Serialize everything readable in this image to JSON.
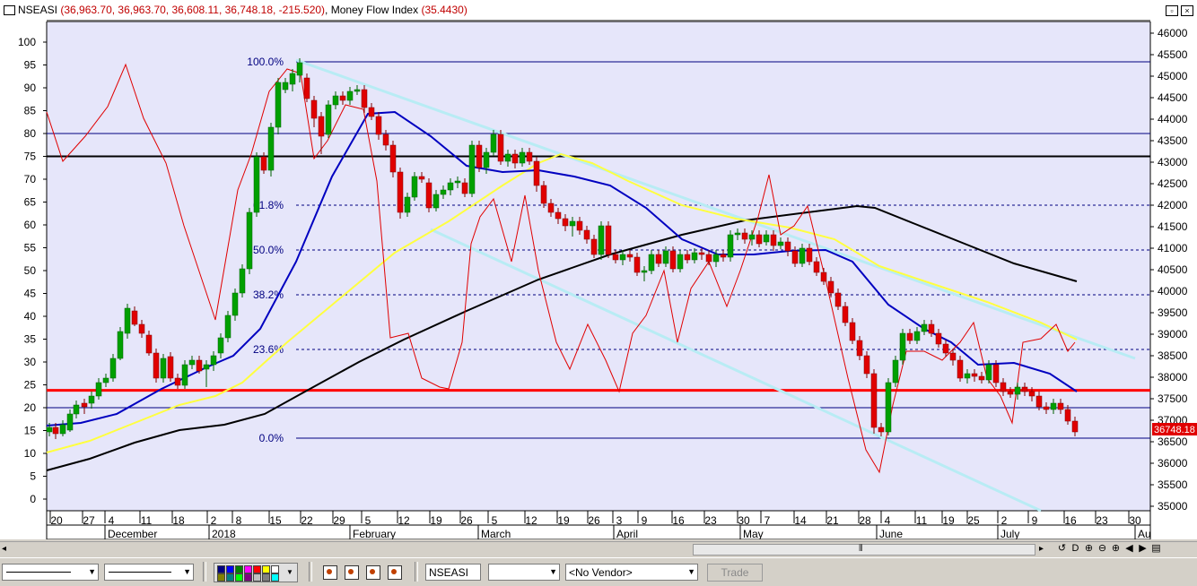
{
  "window": {
    "symbol": "NSEASI",
    "ohlc_text": "(36,963.70, 36,963.70, 36,608.11, 36,748.18, -215.520)",
    "indicator_name": "Money Flow Index",
    "indicator_value": "(35.4430)",
    "restore_label": "▫",
    "close_label": "×"
  },
  "chart": {
    "left_axis_ticks": [
      "100",
      "95",
      "90",
      "85",
      "80",
      "75",
      "70",
      "65",
      "60",
      "55",
      "50",
      "45",
      "40",
      "35",
      "30",
      "25",
      "20",
      "15",
      "10",
      "5",
      "0"
    ],
    "right_axis_ticks": [
      "46000",
      "45500",
      "45000",
      "44500",
      "44000",
      "43500",
      "43000",
      "42500",
      "42000",
      "41500",
      "41000",
      "40500",
      "40000",
      "39500",
      "39000",
      "38500",
      "38000",
      "37500",
      "37000",
      "36500",
      "36000",
      "35500",
      "35000"
    ],
    "last_price": "36748.18",
    "fib_labels": [
      "100.0%",
      "61.8%",
      "50.0%",
      "38.2%",
      "23.6%",
      "0.0%"
    ],
    "day_ticks": [
      "20",
      "27",
      "4",
      "11",
      "18",
      "2",
      "8",
      "15",
      "22",
      "29",
      "5",
      "12",
      "19",
      "26",
      "5",
      "12",
      "19",
      "26",
      "3",
      "9",
      "16",
      "23",
      "30",
      "7",
      "14",
      "21",
      "28",
      "4",
      "11",
      "19",
      "25",
      "2",
      "9",
      "16",
      "23",
      "30"
    ],
    "month_labels": [
      "December",
      "2018",
      "February",
      "March",
      "April",
      "May",
      "June",
      "July",
      "Au"
    ],
    "colors": {
      "background": "#e6e6fa",
      "up_candle": "#00a000",
      "down_candle": "#e00000",
      "mfi": "#e00000",
      "ma_fast": "#0000c0",
      "ma_mid": "#ffff40",
      "ma_slow": "#000000",
      "trend_channel": "#b8ecf4",
      "fib": "#000080",
      "support": "#ff0000"
    }
  },
  "scrollbar": {
    "grip": "⦀",
    "nav_buttons": [
      "◁",
      "▷",
      "↺",
      "D",
      "⊕",
      "⊖",
      "⊕",
      "◀",
      "▶",
      "▤"
    ]
  },
  "toolbar": {
    "line_style_1": "",
    "line_style_2": "",
    "symbol_value": "NSEASI",
    "period_value": "",
    "vendor_value": "<No Vendor>",
    "trade_label": "Trade"
  }
}
